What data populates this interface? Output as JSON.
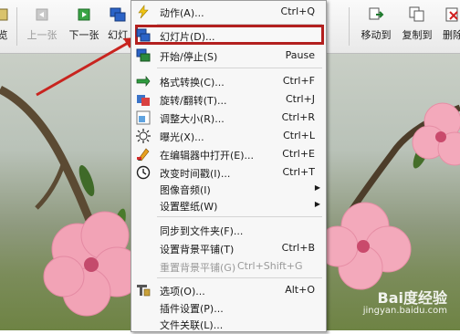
{
  "toolbar": {
    "items": [
      {
        "label": "览",
        "icon": "partial-tool-icon"
      },
      {
        "label": "上一张",
        "icon": "previous-icon",
        "disabled": true
      },
      {
        "label": "下一张",
        "icon": "next-icon"
      },
      {
        "label": "幻灯",
        "icon": "slideshow-icon"
      },
      {
        "label": "移动到",
        "icon": "move-to-icon"
      },
      {
        "label": "复制到",
        "icon": "copy-to-icon"
      },
      {
        "label": "删除",
        "icon": "delete-icon"
      }
    ]
  },
  "menu": {
    "items": [
      {
        "label": "动作(A)...",
        "shortcut": "Ctrl+Q",
        "icon": "lightning-icon"
      },
      {
        "label": "幻灯片(D)...",
        "shortcut": "",
        "icon": "slideshow-icon",
        "highlighted": true
      },
      {
        "label": "开始/停止(S)",
        "shortcut": "Pause",
        "icon": "start-stop-icon"
      },
      {
        "label": "格式转换(C)...",
        "shortcut": "Ctrl+F",
        "icon": "convert-icon"
      },
      {
        "label": "旋转/翻转(T)...",
        "shortcut": "Ctrl+J",
        "icon": "rotate-icon"
      },
      {
        "label": "调整大小(R)...",
        "shortcut": "Ctrl+R",
        "icon": "resize-icon"
      },
      {
        "label": "曝光(X)...",
        "shortcut": "Ctrl+L",
        "icon": "exposure-icon"
      },
      {
        "label": "在编辑器中打开(E)...",
        "shortcut": "Ctrl+E",
        "icon": "editor-icon"
      },
      {
        "label": "改变时间戳(I)...",
        "shortcut": "Ctrl+T",
        "icon": "clock-icon"
      },
      {
        "label": "图像音频(I)",
        "shortcut": "",
        "submenu": true
      },
      {
        "label": "设置壁纸(W)",
        "shortcut": "",
        "submenu": true
      },
      {
        "label": "同步到文件夹(F)...",
        "shortcut": ""
      },
      {
        "label": "设置背景平铺(T)",
        "shortcut": "Ctrl+B"
      },
      {
        "label": "重置背景平铺(G)",
        "shortcut": "Ctrl+Shift+G",
        "disabled": true
      },
      {
        "label": "选项(O)...",
        "shortcut": "Alt+O",
        "icon": "options-icon"
      },
      {
        "label": "插件设置(P)...",
        "shortcut": ""
      },
      {
        "label": "文件关联(L)...",
        "shortcut": ""
      }
    ]
  },
  "watermark": {
    "brand": "Bai度经验",
    "url": "jingyan.baidu.com"
  },
  "colors": {
    "highlight": "#b3201f",
    "arrow": "#c8241f"
  }
}
